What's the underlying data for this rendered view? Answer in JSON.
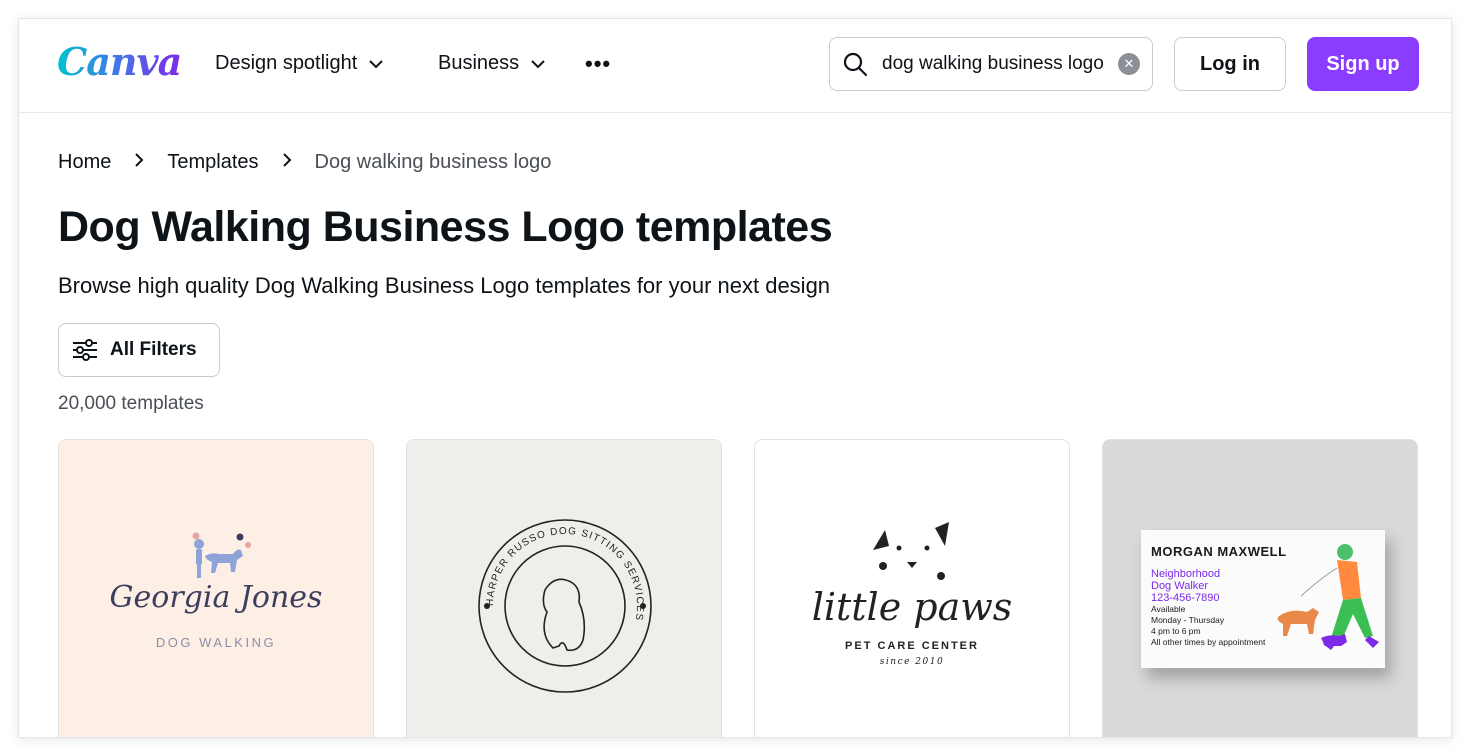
{
  "header": {
    "logo": "Canva",
    "nav": [
      {
        "label": "Design spotlight"
      },
      {
        "label": "Business"
      }
    ],
    "more": "•••",
    "search": {
      "value": "dog walking business logo"
    },
    "login_label": "Log in",
    "signup_label": "Sign up"
  },
  "breadcrumb": {
    "home": "Home",
    "templates": "Templates",
    "current": "Dog walking business logo"
  },
  "page": {
    "title": "Dog Walking Business Logo templates",
    "subtitle": "Browse high quality Dog Walking Business Logo templates for your next design",
    "filters_label": "All Filters",
    "count": "20,000 templates"
  },
  "cards": {
    "c1": {
      "name": "Georgia Jones",
      "sub": "DOG WALKING"
    },
    "c2": {
      "ring_text": "HARPER RUSSO DOG SITTING SERVICES"
    },
    "c3": {
      "name": "little paws",
      "sub": "PET CARE CENTER",
      "since": "since 2010"
    },
    "c4": {
      "name": "MORGAN MAXWELL",
      "role1": "Neighborhood",
      "role2": "Dog Walker",
      "phone": "123-456-7890",
      "l1": "Available",
      "l2": "Monday - Thursday",
      "l3": "4 pm to 6 pm",
      "l4": "All other times by  appointment"
    }
  },
  "colors": {
    "brand_purple": "#8b3dff",
    "canva_teal": "#00c4cc"
  }
}
